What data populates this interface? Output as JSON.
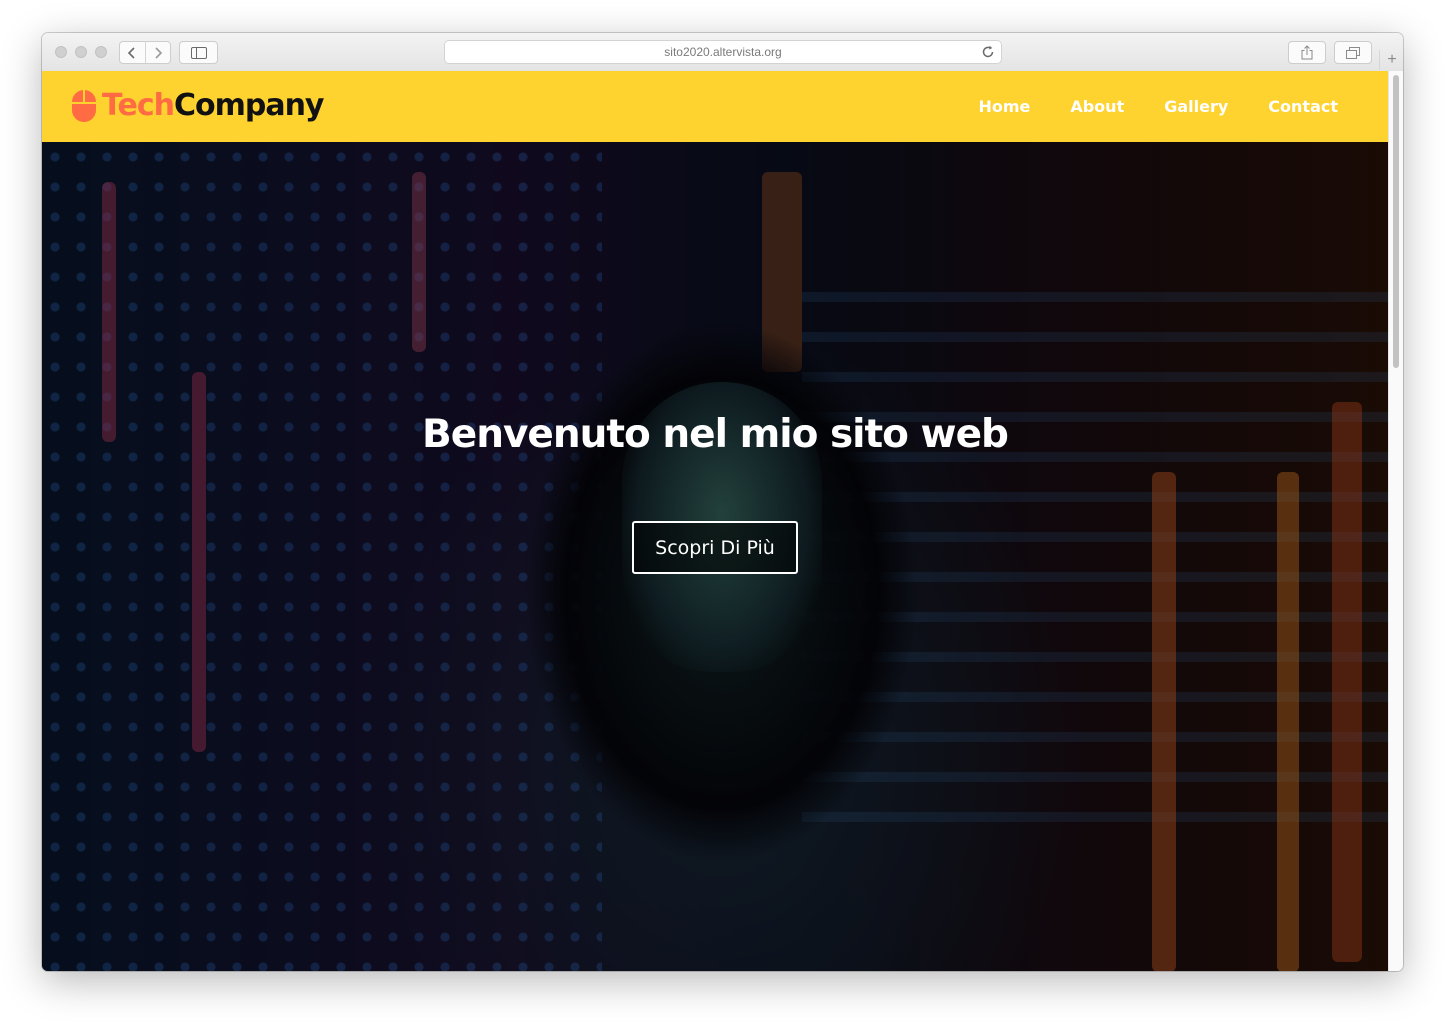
{
  "browser": {
    "url": "sito2020.altervista.org",
    "icons": {
      "back": "chevron-left-icon",
      "forward": "chevron-right-icon",
      "sidebar": "sidebar-icon",
      "reload": "reload-icon",
      "share": "share-icon",
      "tabs": "tabs-overview-icon",
      "new_tab": "plus-icon"
    }
  },
  "site": {
    "logo": {
      "part1": "Tech",
      "part2": "Company",
      "icon": "mouse-icon"
    },
    "nav": [
      {
        "label": "Home"
      },
      {
        "label": "About"
      },
      {
        "label": "Gallery"
      },
      {
        "label": "Contact"
      }
    ],
    "hero": {
      "title": "Benvenuto nel mio sito web",
      "button_label": "Scopri Di Più"
    },
    "colors": {
      "navbar_bg": "#fed22f",
      "logo_accent": "#ff6b42",
      "logo_dark": "#111111",
      "nav_text": "#ffffff"
    }
  }
}
